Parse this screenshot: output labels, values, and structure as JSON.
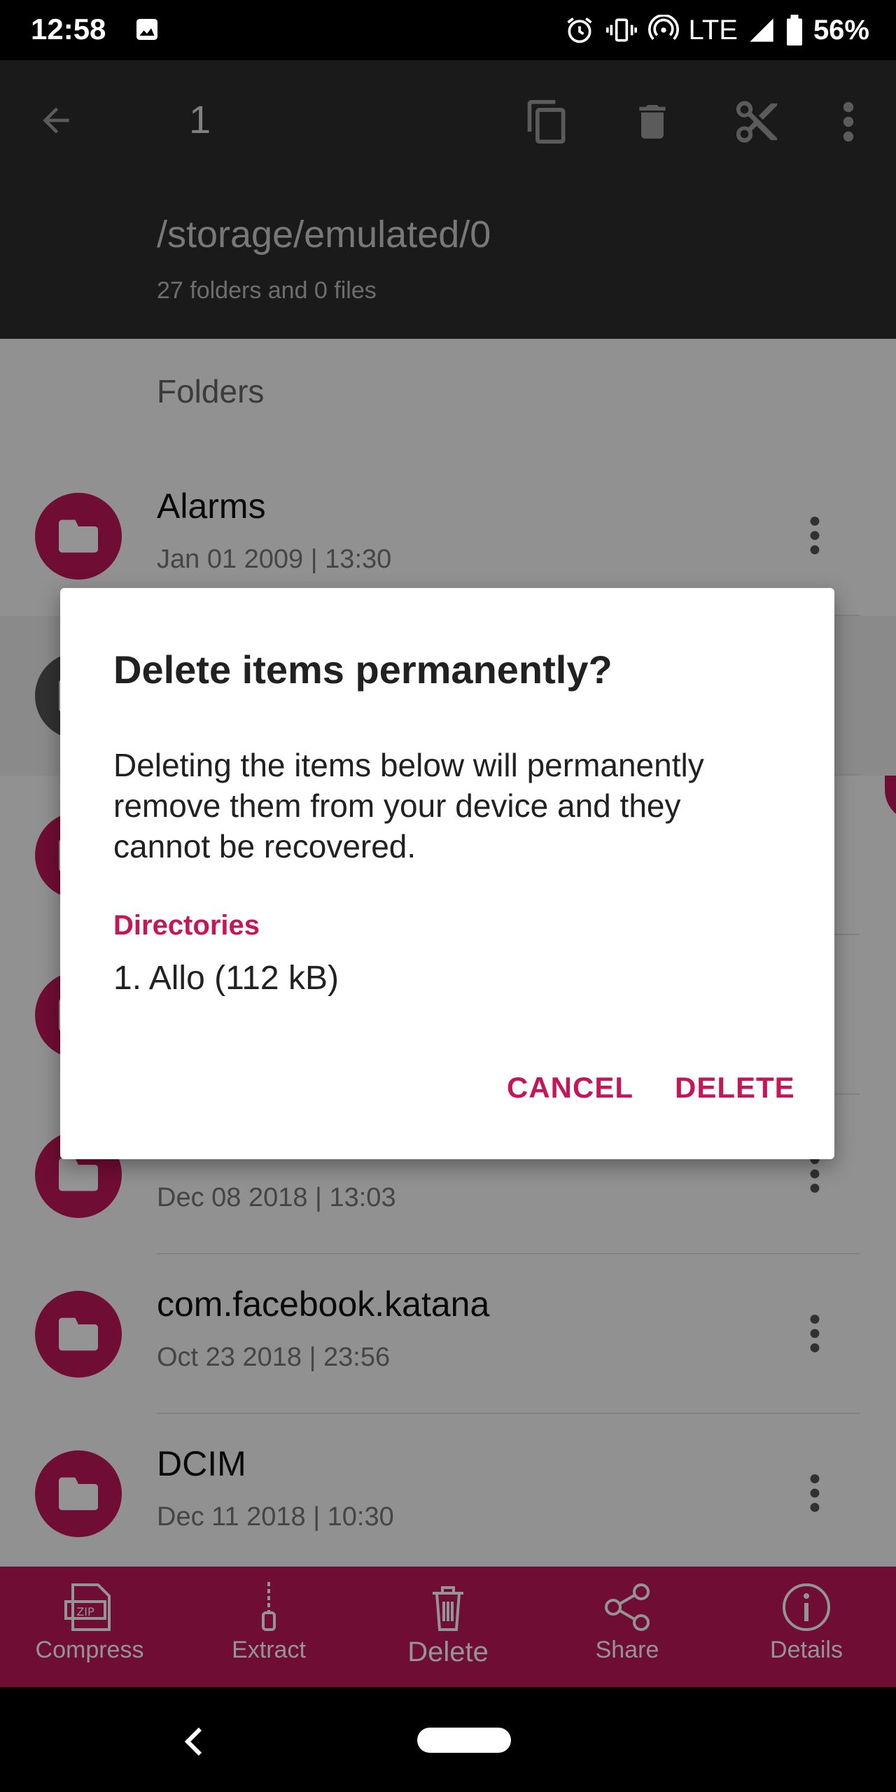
{
  "status_bar": {
    "time": "12:58",
    "network": "LTE",
    "battery": "56%"
  },
  "toolbar": {
    "selected_count": "1",
    "path": "/storage/emulated/0",
    "summary": "27 folders and 0 files",
    "icons": [
      "back-arrow-icon",
      "copy-icon",
      "trash-icon",
      "cut-icon",
      "more-vert-icon"
    ]
  },
  "list": {
    "section_label": "Folders",
    "rows": [
      {
        "name": "Alarms",
        "date": "Jan 01 2009 | 13:30",
        "selected": false
      },
      {
        "name": "",
        "date": "",
        "selected": true
      },
      {
        "name": "",
        "date": "",
        "selected": false
      },
      {
        "name": "",
        "date": "",
        "selected": false
      },
      {
        "name": "",
        "date": "Dec 08 2018 | 13:03",
        "selected": false
      },
      {
        "name": "com.facebook.katana",
        "date": "Oct 23 2018 | 23:56",
        "selected": false
      },
      {
        "name": "DCIM",
        "date": "Dec 11 2018 | 10:30",
        "selected": false
      }
    ]
  },
  "bottom_bar": {
    "items": [
      {
        "label": "Compress",
        "icon": "zip-icon"
      },
      {
        "label": "Extract",
        "icon": "zipper-icon"
      },
      {
        "label": "Delete",
        "icon": "trash-icon"
      },
      {
        "label": "Share",
        "icon": "share-icon"
      },
      {
        "label": "Details",
        "icon": "info-icon"
      }
    ]
  },
  "dialog": {
    "title": "Delete items permanently?",
    "message": "Deleting the items below will permanently remove them from your device and they cannot be recovered.",
    "section": "Directories",
    "items": [
      "1. Allo (112 kB)"
    ],
    "cancel_label": "CANCEL",
    "delete_label": "DELETE"
  },
  "colors": {
    "accent": "#c2185b",
    "toolbar": "#2d2d2d"
  }
}
